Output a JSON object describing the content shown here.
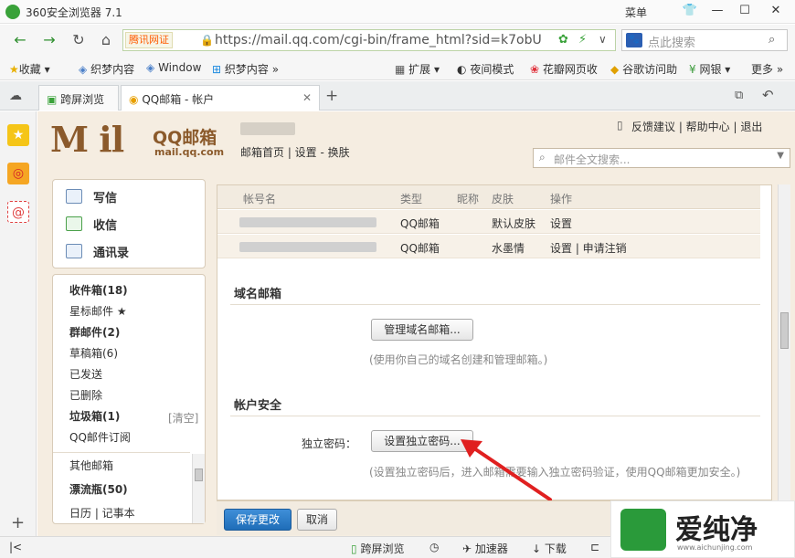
{
  "window": {
    "title": "360安全浏览器 7.1",
    "menu_label": "菜单"
  },
  "nav": {
    "badge": "腾讯网",
    "badge_mark": "证",
    "url": "https://mail.qq.com/cgi-bin/frame_html?sid=k7obU",
    "search_placeholder": "点此搜索"
  },
  "bookmarks": {
    "left": [
      "收藏",
      "织梦内容",
      "Window",
      "织梦内容"
    ],
    "right": [
      "扩展",
      "夜间模式",
      "花瓣网页收",
      "谷歌访问助",
      "网银",
      "更多"
    ]
  },
  "tabs": [
    {
      "label": "跨屏浏览"
    },
    {
      "label": "QQ邮箱 - 帐户"
    }
  ],
  "header": {
    "logo_text": "M il",
    "brand_cn": "QQ邮箱",
    "brand_en": "mail.qq.com",
    "topnav": "邮箱首页 | 设置 - 换肤",
    "toplinks": "反馈建议 | 帮助中心 | 退出",
    "search_placeholder": "邮件全文搜索..."
  },
  "quick_actions": [
    "写信",
    "收信",
    "通讯录"
  ],
  "folders": [
    {
      "label": "收件箱(18)",
      "bold": true
    },
    {
      "label": "星标邮件 ★",
      "bold": false
    },
    {
      "label": "群邮件(2)",
      "bold": true
    },
    {
      "label": "草稿箱(6)",
      "bold": false
    },
    {
      "label": "已发送",
      "bold": false
    },
    {
      "label": "已删除",
      "bold": false
    },
    {
      "label": "垃圾箱(1)",
      "bold": true
    },
    {
      "label": "QQ邮件订阅",
      "bold": false
    }
  ],
  "trash_clear": "[清空]",
  "folders_more": [
    {
      "label": "其他邮箱",
      "bold": false
    },
    {
      "label": "漂流瓶(50)",
      "bold": true
    },
    {
      "label": "日历 | 记事本",
      "bold": false
    }
  ],
  "accounts_table": {
    "headers": [
      "帐号名",
      "类型",
      "昵称",
      "皮肤",
      "操作"
    ],
    "rows": [
      {
        "type": "QQ邮箱",
        "skin": "默认皮肤",
        "action": "设置"
      },
      {
        "type": "QQ邮箱",
        "skin": "水墨情",
        "action": "设置 | 申请注销"
      }
    ]
  },
  "domain_section": {
    "title": "域名邮箱",
    "button": "管理域名邮箱...",
    "hint": "(使用你自己的域名创建和管理邮箱。)"
  },
  "security_section": {
    "title": "帐户安全",
    "field_label": "独立密码：",
    "button": "设置独立密码...",
    "hint": "(设置独立密码后，进入邮箱需要输入独立密码验证，使用QQ邮箱更加安全。)"
  },
  "actions": {
    "save": "保存更改",
    "cancel": "取消"
  },
  "statusbar": {
    "items": [
      "跨屏浏览",
      "加速器",
      "下载"
    ]
  },
  "watermark": {
    "text": "爱纯净",
    "url": "www.aichunjing.com"
  }
}
